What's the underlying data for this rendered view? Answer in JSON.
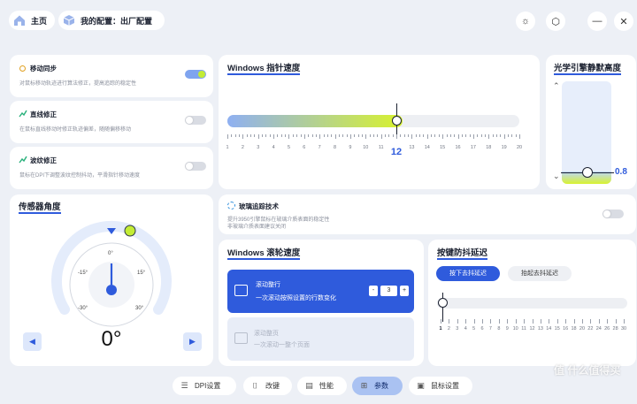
{
  "header": {
    "home": "主页",
    "config": "我的配置：出厂配置"
  },
  "motion_sync": {
    "title": "移动同步",
    "desc": "对鼠标移动轨迹进行算法修正，提高追踪的稳定性"
  },
  "angle_snapping": {
    "title": "直线修正",
    "desc": "在鼠标直线移动时修正轨迹偏差，随随偏移移动"
  },
  "ripple_control": {
    "title": "波纹修正",
    "desc": "鼠标在DPI下调整波纹控制抖动，平滑指针移动速度"
  },
  "pointer_speed": {
    "title": "Windows 指针速度",
    "value": "12",
    "value_num": 12,
    "min": 1,
    "max": 20,
    "ticks": [
      "1",
      "2",
      "3",
      "4",
      "5",
      "6",
      "7",
      "8",
      "9",
      "10",
      "11",
      "12",
      "13",
      "14",
      "15",
      "16",
      "17",
      "18",
      "19",
      "20"
    ]
  },
  "lod": {
    "title": "光学引擎静默高度",
    "value": "0.8",
    "up": "⌃",
    "down": "⌄"
  },
  "sensor_angle": {
    "title": "传感器角度",
    "value": "0°",
    "labels": {
      "top": "0°",
      "l15": "-15°",
      "r15": "15°",
      "l30": "-30°",
      "r30": "30°"
    },
    "left": "◀",
    "right": "▶"
  },
  "glass_tracking": {
    "title": "玻璃追踪技术",
    "desc1": "提升3950引擎鼠标在玻璃介质表面的稳定性",
    "desc2": "非玻璃介质表面建议关闭"
  },
  "scroll_speed": {
    "title": "Windows 滚轮速度",
    "options": [
      {
        "title": "滚动整行",
        "desc": "一次滚动按照设置的行数变化"
      },
      {
        "title": "滚动整页",
        "desc": "一次滚动一整个页面"
      }
    ],
    "lines": "3",
    "minus": "-",
    "plus": "+"
  },
  "debounce": {
    "title": "按键防抖延迟",
    "tab_press": "按下去抖延迟",
    "tab_release": "抬起去抖延迟",
    "ticks": [
      "1",
      "2",
      "3",
      "4",
      "5",
      "6",
      "7",
      "8",
      "9",
      "10",
      "11",
      "12",
      "13",
      "14",
      "15",
      "16",
      "18",
      "20",
      "22",
      "24",
      "26",
      "28",
      "30"
    ]
  },
  "bottom_tabs": [
    "DPI设置",
    "改键",
    "性能",
    "参数",
    "鼠标设置"
  ],
  "watermark": "值 什么值得买",
  "colors": {
    "accent": "#2f5bdc",
    "lime": "#c3ec35",
    "active_tab": "#aac2f2"
  }
}
